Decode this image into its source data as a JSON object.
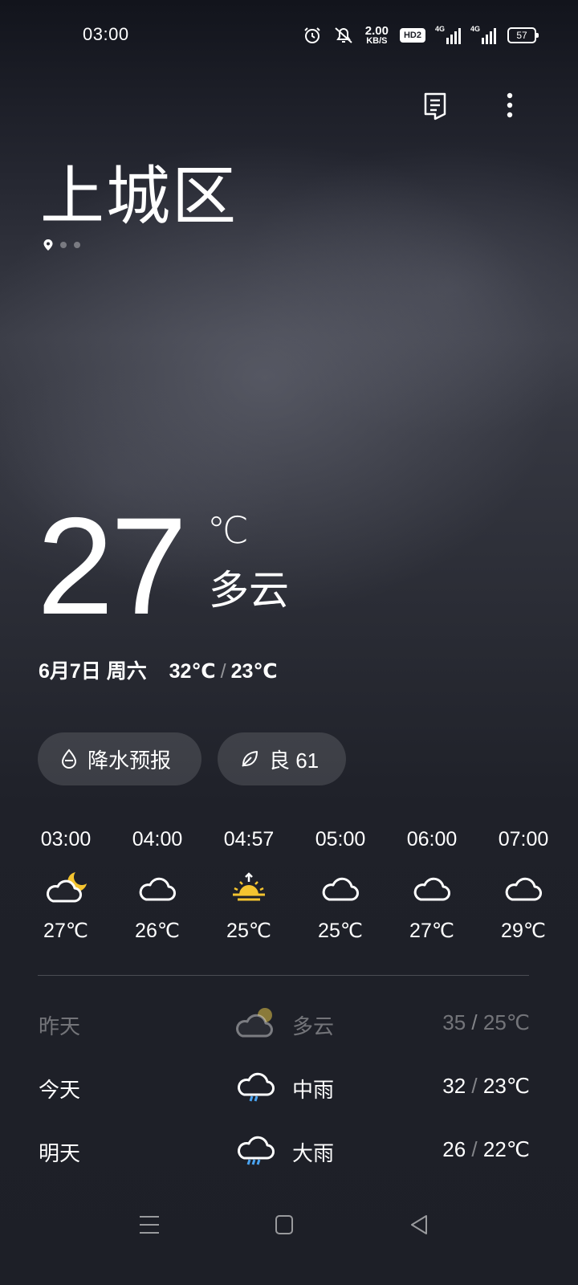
{
  "status_bar": {
    "time": "03:00",
    "speed_value": "2.00",
    "speed_unit": "KB/S",
    "hd_label": "HD2",
    "sim1_label": "4G",
    "sim2_label": "4G",
    "battery": "57",
    "icons": [
      "alarm-icon",
      "mute-icon",
      "speed",
      "hd-icon",
      "signal-icon",
      "signal-icon",
      "battery-icon"
    ]
  },
  "header": {
    "actions": [
      "report-icon",
      "more-icon"
    ]
  },
  "location": {
    "city": "上城区",
    "page_count": 3,
    "current_page": 1
  },
  "current": {
    "temp": "27",
    "unit": "℃",
    "condition": "多云",
    "date": "6月7日 周六",
    "high": "32℃",
    "sep": "/",
    "low": "23℃"
  },
  "chips": {
    "rain": {
      "label": "降水预报",
      "icon": "raindrop-icon"
    },
    "aqi": {
      "label": "良 61",
      "icon": "leaf-icon"
    }
  },
  "hourly": [
    {
      "time": "03:00",
      "icon": "cloud-moon-icon",
      "temp": "27℃"
    },
    {
      "time": "04:00",
      "icon": "cloud-icon",
      "temp": "26℃"
    },
    {
      "time": "04:57",
      "icon": "sunrise-icon",
      "temp": "25℃"
    },
    {
      "time": "05:00",
      "icon": "cloud-icon",
      "temp": "25℃"
    },
    {
      "time": "06:00",
      "icon": "cloud-icon",
      "temp": "27℃"
    },
    {
      "time": "07:00",
      "icon": "cloud-icon",
      "temp": "29℃"
    }
  ],
  "daily": [
    {
      "name": "昨天",
      "icon": "cloud-sun-icon",
      "condition": "多云",
      "high": "35",
      "sep": "/",
      "low": "25℃"
    },
    {
      "name": "今天",
      "icon": "rain-cloud-icon",
      "condition": "中雨",
      "high": "32",
      "sep": "/",
      "low": "23℃"
    },
    {
      "name": "明天",
      "icon": "heavy-rain-icon",
      "condition": "大雨",
      "high": "26",
      "sep": "/",
      "low": "22℃"
    }
  ],
  "colors": {
    "background_top": "#12141c",
    "background_bottom": "#1d1f27",
    "sun_yellow": "#f4c430",
    "rain_blue": "#4aa3f0"
  }
}
